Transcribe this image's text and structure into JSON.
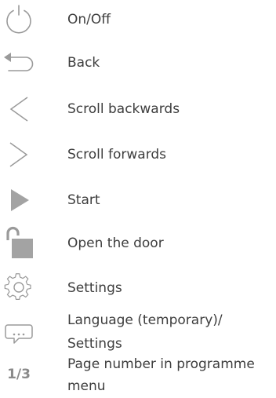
{
  "legend": {
    "items": [
      {
        "icon": "power-icon",
        "label": "On/Off"
      },
      {
        "icon": "back-arrow-icon",
        "label": "Back"
      },
      {
        "icon": "chevron-left-icon",
        "label": "Scroll backwards"
      },
      {
        "icon": "chevron-right-icon",
        "label": "Scroll forwards"
      },
      {
        "icon": "play-icon",
        "label": "Start"
      },
      {
        "icon": "unlock-icon",
        "label": "Open the door"
      },
      {
        "icon": "gear-icon",
        "label": "Settings"
      },
      {
        "icon": "speech-bubble-icon",
        "label_line1": "Language (temporary)/",
        "label_line2": "Settings"
      },
      {
        "icon": "page-number",
        "icon_text": "1/3",
        "label_line1": "Page number in programme",
        "label_line2": "menu"
      }
    ]
  },
  "colors": {
    "text": "#3d3d3d",
    "icon_outline": "#9a9a9a",
    "icon_fill": "#a3a3a3"
  }
}
